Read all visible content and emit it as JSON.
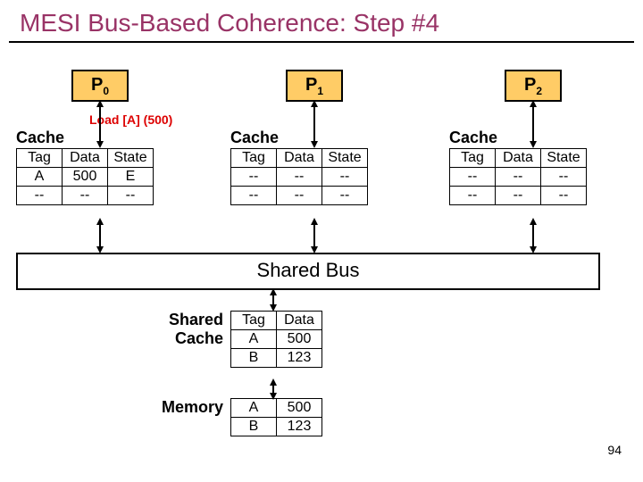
{
  "title": "MESI Bus-Based Coherence: Step #4",
  "processors": {
    "p0": "P",
    "p0s": "0",
    "p1": "P",
    "p1s": "1",
    "p2": "P",
    "p2s": "2"
  },
  "load_label": "Load [A] (500)",
  "cache_word": "Cache",
  "headers": {
    "tag": "Tag",
    "data": "Data",
    "state": "State"
  },
  "cache0": {
    "r1": {
      "tag": "A",
      "data": "500",
      "state": "E"
    },
    "r2": {
      "tag": "--",
      "data": "--",
      "state": "--"
    }
  },
  "cache1": {
    "r1": {
      "tag": "--",
      "data": "--",
      "state": "--"
    },
    "r2": {
      "tag": "--",
      "data": "--",
      "state": "--"
    }
  },
  "cache2": {
    "r1": {
      "tag": "--",
      "data": "--",
      "state": "--"
    },
    "r2": {
      "tag": "--",
      "data": "--",
      "state": "--"
    }
  },
  "bus_label": "Shared Bus",
  "shared_cache_label1": "Shared",
  "shared_cache_label2": "Cache",
  "memory_label": "Memory",
  "shared_cache": {
    "r1": {
      "tag": "A",
      "data": "500"
    },
    "r2": {
      "tag": "B",
      "data": "123"
    }
  },
  "memory": {
    "r1": {
      "tag": "A",
      "data": "500"
    },
    "r2": {
      "tag": "B",
      "data": "123"
    }
  },
  "page": "94"
}
